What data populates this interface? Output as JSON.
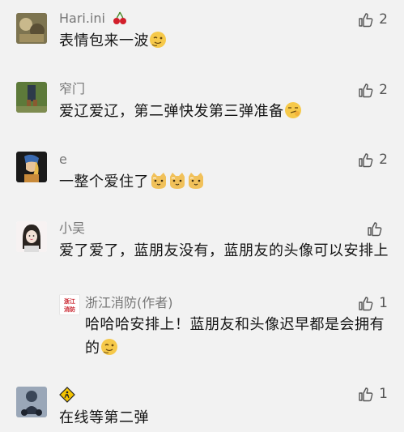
{
  "comments": [
    {
      "name": "Hari.ini",
      "name_badge": "cherries-emoji",
      "text": "表情包来一波",
      "likes": "2",
      "emoji": "wink-emoji"
    },
    {
      "name": "窄门",
      "text": "爱辽爱辽，第二弹快发第三弹准备",
      "likes": "2",
      "emoji": "smirk-emoji"
    },
    {
      "name": "e",
      "text": "一整个爱住了",
      "likes": "2",
      "emoji": "cat-face-emoji"
    },
    {
      "name": "小吴",
      "text": "爱了爱了，蓝朋友没有，蓝朋友的头像可以安排上",
      "likes": ""
    },
    {
      "name": "浙江消防(作者)",
      "avatar_text": "浙江消防",
      "text": "哈哈哈安排上！蓝朋友和头像迟早都是会拥有的",
      "likes": "1",
      "emoji": "wink-emoji"
    },
    {
      "name": "",
      "name_badge": "caution-sign-icon",
      "text": "在线等第二弹",
      "likes": "1"
    }
  ],
  "colors": {
    "background": "#f2f2f2",
    "name": "#777777",
    "text": "#151515",
    "like_icon": "#555555"
  }
}
